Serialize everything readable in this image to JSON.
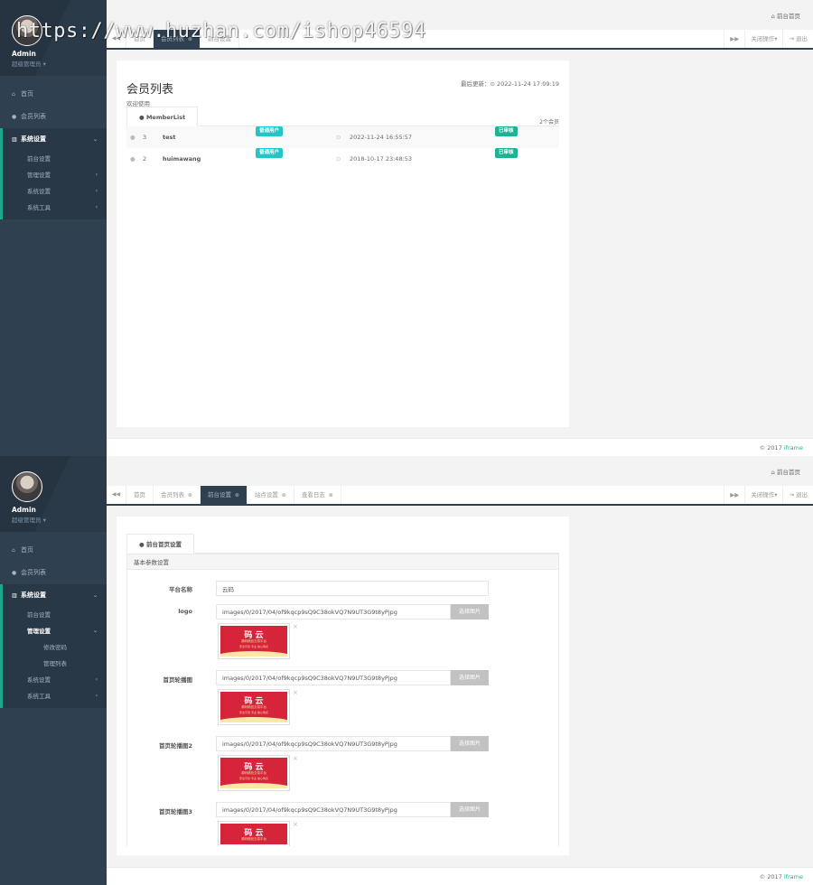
{
  "watermark": "https://www.huzhan.com/ishop46594",
  "profile": {
    "name": "Admin",
    "role": "超级管理员 ▾"
  },
  "topbar": {
    "front_link": "前台首页"
  },
  "tabbar": {
    "close_ops": "关闭操作▾",
    "logout": "退出"
  },
  "screen1": {
    "nav": [
      {
        "label": "首页",
        "icon": "home-icon"
      },
      {
        "label": "会员列表",
        "icon": "user-icon"
      }
    ],
    "system": {
      "label": "系统设置",
      "icon": "columns-icon"
    },
    "system_sub": [
      "前台设置",
      "管理设置",
      "系统设置",
      "系统工具"
    ],
    "tabs": [
      {
        "label": "首页"
      },
      {
        "label": "会员列表"
      },
      {
        "label": "前台设置"
      }
    ],
    "page": {
      "title": "会员列表",
      "subtitle": "欢迎使用",
      "updated": "最后更新：⊙ 2022-11-24 17:09:19",
      "count": "2个会员",
      "tab": "MemberList"
    },
    "members": [
      {
        "id": "3",
        "name": "test",
        "type": "普通用户",
        "time": "2022-11-24 16:55:57",
        "status": "已审核"
      },
      {
        "id": "2",
        "name": "huimawang",
        "type": "普通用户",
        "time": "2018-10-17 23:48:53",
        "status": "已审核"
      }
    ]
  },
  "screen2": {
    "nav": [
      {
        "label": "首页",
        "icon": "home-icon"
      },
      {
        "label": "会员列表",
        "icon": "user-icon"
      }
    ],
    "system": {
      "label": "系统设置",
      "icon": "columns-icon"
    },
    "system_sub_first": "前台设置",
    "admin_group": {
      "label": "管理设置",
      "children": [
        "修改密码",
        "管理列表"
      ]
    },
    "system_sub_rest": [
      "系统设置",
      "系统工具"
    ],
    "tabs": [
      {
        "label": "首页"
      },
      {
        "label": "会员列表"
      },
      {
        "label": "前台设置"
      },
      {
        "label": "站点设置"
      },
      {
        "label": "查看日志"
      }
    ],
    "page": {
      "tab": "前台首页设置",
      "section": "基本参数设置",
      "site_name_label": "平台名称",
      "site_name_value": "云码",
      "choose_image": "选择图片",
      "image_fields": [
        {
          "label": "logo",
          "path": "images/0/2017/04/of9kqcp9sQ9C38okVQ7N9UT3G9t8yPjpg"
        },
        {
          "label": "首页轮播图",
          "path": "images/0/2017/04/of9kqcp9sQ9C38okVQ7N9UT3G9t8yPjpg"
        },
        {
          "label": "首页轮播图2",
          "path": "images/0/2017/04/of9kqcp9sQ9C38okVQ7N9UT3G9t8yPjpg"
        },
        {
          "label": "首页轮播图3",
          "path": "images/0/2017/04/of9kqcp9sQ9C38okVQ7N9UT3G9t8yPjpg"
        }
      ],
      "thumb": {
        "line1": "码 云",
        "line2": "源码精品交易平台",
        "line3": "安全可靠·专业·放心购买"
      }
    }
  },
  "footer": {
    "copyright": "© 2017 ",
    "brand": "iframe"
  },
  "colors": {
    "sidebar": "#2f4050",
    "accent": "#1ab394",
    "info": "#23c6c8"
  }
}
